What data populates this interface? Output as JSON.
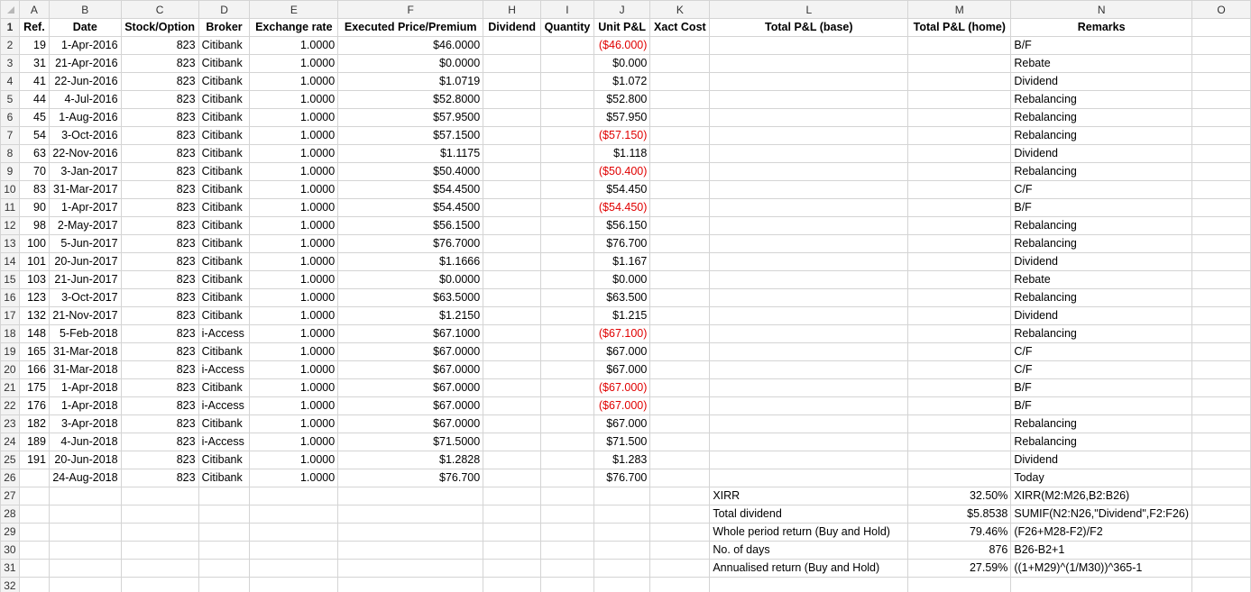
{
  "columns": [
    "A",
    "B",
    "C",
    "D",
    "E",
    "F",
    "H",
    "I",
    "J",
    "K",
    "L",
    "M",
    "N",
    "O"
  ],
  "header": {
    "ref": "Ref.",
    "date": "Date",
    "stock": "Stock/Option",
    "broker": "Broker",
    "rate": "Exchange rate",
    "price": "Executed Price/Premium",
    "dividend": "Dividend",
    "quantity": "Quantity",
    "unit_pl": "Unit P&L",
    "xact": "Xact Cost",
    "total_base": "Total P&L (base)",
    "total_home": "Total P&L (home)",
    "remarks": "Remarks"
  },
  "rows": [
    {
      "ref": "19",
      "date": "1-Apr-2016",
      "stock": "823",
      "broker": "Citibank",
      "rate": "1.0000",
      "price": "$46.0000",
      "unit": "($46.000)",
      "neg": true,
      "remark": "B/F"
    },
    {
      "ref": "31",
      "date": "21-Apr-2016",
      "stock": "823",
      "broker": "Citibank",
      "rate": "1.0000",
      "price": "$0.0000",
      "unit": "$0.000",
      "neg": false,
      "remark": "Rebate"
    },
    {
      "ref": "41",
      "date": "22-Jun-2016",
      "stock": "823",
      "broker": "Citibank",
      "rate": "1.0000",
      "price": "$1.0719",
      "unit": "$1.072",
      "neg": false,
      "remark": "Dividend"
    },
    {
      "ref": "44",
      "date": "4-Jul-2016",
      "stock": "823",
      "broker": "Citibank",
      "rate": "1.0000",
      "price": "$52.8000",
      "unit": "$52.800",
      "neg": false,
      "remark": "Rebalancing"
    },
    {
      "ref": "45",
      "date": "1-Aug-2016",
      "stock": "823",
      "broker": "Citibank",
      "rate": "1.0000",
      "price": "$57.9500",
      "unit": "$57.950",
      "neg": false,
      "remark": "Rebalancing"
    },
    {
      "ref": "54",
      "date": "3-Oct-2016",
      "stock": "823",
      "broker": "Citibank",
      "rate": "1.0000",
      "price": "$57.1500",
      "unit": "($57.150)",
      "neg": true,
      "remark": "Rebalancing"
    },
    {
      "ref": "63",
      "date": "22-Nov-2016",
      "stock": "823",
      "broker": "Citibank",
      "rate": "1.0000",
      "price": "$1.1175",
      "unit": "$1.118",
      "neg": false,
      "remark": "Dividend"
    },
    {
      "ref": "70",
      "date": "3-Jan-2017",
      "stock": "823",
      "broker": "Citibank",
      "rate": "1.0000",
      "price": "$50.4000",
      "unit": "($50.400)",
      "neg": true,
      "remark": "Rebalancing"
    },
    {
      "ref": "83",
      "date": "31-Mar-2017",
      "stock": "823",
      "broker": "Citibank",
      "rate": "1.0000",
      "price": "$54.4500",
      "unit": "$54.450",
      "neg": false,
      "remark": "C/F"
    },
    {
      "ref": "90",
      "date": "1-Apr-2017",
      "stock": "823",
      "broker": "Citibank",
      "rate": "1.0000",
      "price": "$54.4500",
      "unit": "($54.450)",
      "neg": true,
      "remark": "B/F"
    },
    {
      "ref": "98",
      "date": "2-May-2017",
      "stock": "823",
      "broker": "Citibank",
      "rate": "1.0000",
      "price": "$56.1500",
      "unit": "$56.150",
      "neg": false,
      "remark": "Rebalancing"
    },
    {
      "ref": "100",
      "date": "5-Jun-2017",
      "stock": "823",
      "broker": "Citibank",
      "rate": "1.0000",
      "price": "$76.7000",
      "unit": "$76.700",
      "neg": false,
      "remark": "Rebalancing"
    },
    {
      "ref": "101",
      "date": "20-Jun-2017",
      "stock": "823",
      "broker": "Citibank",
      "rate": "1.0000",
      "price": "$1.1666",
      "unit": "$1.167",
      "neg": false,
      "remark": "Dividend"
    },
    {
      "ref": "103",
      "date": "21-Jun-2017",
      "stock": "823",
      "broker": "Citibank",
      "rate": "1.0000",
      "price": "$0.0000",
      "unit": "$0.000",
      "neg": false,
      "remark": "Rebate"
    },
    {
      "ref": "123",
      "date": "3-Oct-2017",
      "stock": "823",
      "broker": "Citibank",
      "rate": "1.0000",
      "price": "$63.5000",
      "unit": "$63.500",
      "neg": false,
      "remark": "Rebalancing"
    },
    {
      "ref": "132",
      "date": "21-Nov-2017",
      "stock": "823",
      "broker": "Citibank",
      "rate": "1.0000",
      "price": "$1.2150",
      "unit": "$1.215",
      "neg": false,
      "remark": "Dividend"
    },
    {
      "ref": "148",
      "date": "5-Feb-2018",
      "stock": "823",
      "broker": "i-Access",
      "rate": "1.0000",
      "price": "$67.1000",
      "unit": "($67.100)",
      "neg": true,
      "remark": "Rebalancing"
    },
    {
      "ref": "165",
      "date": "31-Mar-2018",
      "stock": "823",
      "broker": "Citibank",
      "rate": "1.0000",
      "price": "$67.0000",
      "unit": "$67.000",
      "neg": false,
      "remark": "C/F"
    },
    {
      "ref": "166",
      "date": "31-Mar-2018",
      "stock": "823",
      "broker": "i-Access",
      "rate": "1.0000",
      "price": "$67.0000",
      "unit": "$67.000",
      "neg": false,
      "remark": "C/F"
    },
    {
      "ref": "175",
      "date": "1-Apr-2018",
      "stock": "823",
      "broker": "Citibank",
      "rate": "1.0000",
      "price": "$67.0000",
      "unit": "($67.000)",
      "neg": true,
      "remark": "B/F"
    },
    {
      "ref": "176",
      "date": "1-Apr-2018",
      "stock": "823",
      "broker": "i-Access",
      "rate": "1.0000",
      "price": "$67.0000",
      "unit": "($67.000)",
      "neg": true,
      "remark": "B/F"
    },
    {
      "ref": "182",
      "date": "3-Apr-2018",
      "stock": "823",
      "broker": "Citibank",
      "rate": "1.0000",
      "price": "$67.0000",
      "unit": "$67.000",
      "neg": false,
      "remark": "Rebalancing"
    },
    {
      "ref": "189",
      "date": "4-Jun-2018",
      "stock": "823",
      "broker": "i-Access",
      "rate": "1.0000",
      "price": "$71.5000",
      "unit": "$71.500",
      "neg": false,
      "remark": "Rebalancing"
    },
    {
      "ref": "191",
      "date": "20-Jun-2018",
      "stock": "823",
      "broker": "Citibank",
      "rate": "1.0000",
      "price": "$1.2828",
      "unit": "$1.283",
      "neg": false,
      "remark": "Dividend"
    },
    {
      "ref": "",
      "date": "24-Aug-2018",
      "stock": "823",
      "broker": "Citibank",
      "rate": "1.0000",
      "price": "$76.700",
      "unit": "$76.700",
      "neg": false,
      "remark": "Today"
    }
  ],
  "summary": [
    {
      "label": "XIRR",
      "value": "32.50%",
      "formula": "XIRR(M2:M26,B2:B26)"
    },
    {
      "label": "Total dividend",
      "value": "$5.8538",
      "formula": "SUMIF(N2:N26,\"Dividend\",F2:F26)"
    },
    {
      "label": "Whole period return (Buy and Hold)",
      "value": "79.46%",
      "formula": "(F26+M28-F2)/F2"
    },
    {
      "label": "No. of days",
      "value": "876",
      "formula": "B26-B2+1"
    },
    {
      "label": "Annualised return (Buy and Hold)",
      "value": "27.59%",
      "formula": "((1+M29)^(1/M30))^365-1"
    }
  ],
  "row_numbers": [
    "1",
    "2",
    "3",
    "4",
    "5",
    "6",
    "7",
    "8",
    "9",
    "10",
    "11",
    "12",
    "13",
    "14",
    "15",
    "16",
    "17",
    "18",
    "19",
    "20",
    "21",
    "22",
    "23",
    "24",
    "25",
    "26",
    "27",
    "28",
    "29",
    "30",
    "31",
    "32"
  ],
  "colors": {
    "negative": "#e00000",
    "header_bg": "#f3f3f3",
    "grid": "#d4d4d4"
  }
}
